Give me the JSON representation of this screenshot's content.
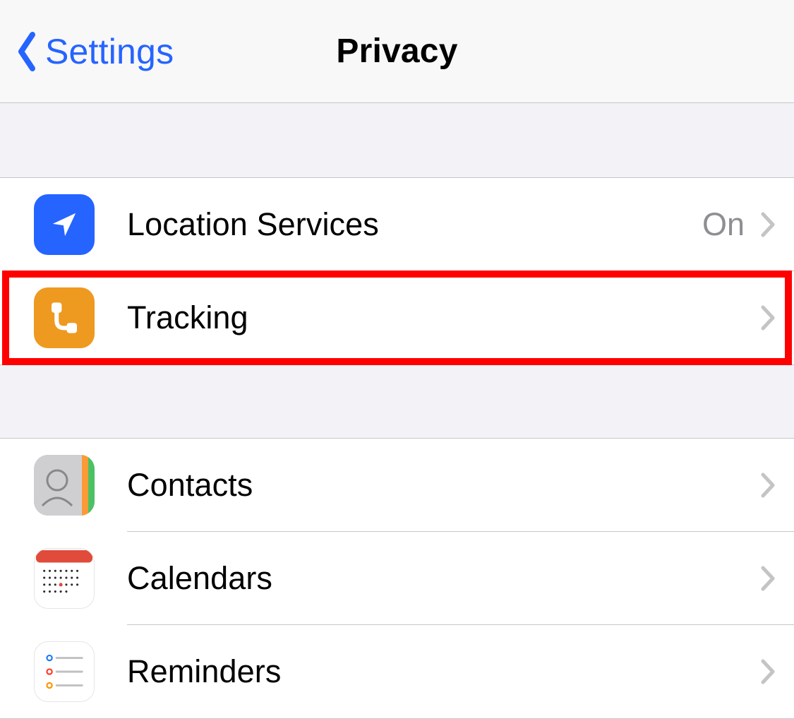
{
  "nav": {
    "back_label": "Settings",
    "title": "Privacy"
  },
  "group1": [
    {
      "id": "location-services",
      "icon": "location-arrow-icon",
      "label": "Location Services",
      "value": "On",
      "highlighted": false
    },
    {
      "id": "tracking",
      "icon": "tracking-icon",
      "label": "Tracking",
      "value": "",
      "highlighted": true
    }
  ],
  "group2": [
    {
      "id": "contacts",
      "icon": "contacts-icon",
      "label": "Contacts",
      "value": ""
    },
    {
      "id": "calendars",
      "icon": "calendar-icon",
      "label": "Calendars",
      "value": ""
    },
    {
      "id": "reminders",
      "icon": "reminders-icon",
      "label": "Reminders",
      "value": ""
    }
  ],
  "colors": {
    "tint": "#2564ff",
    "highlight": "#ff0000",
    "separator": "#c6c6c8"
  }
}
